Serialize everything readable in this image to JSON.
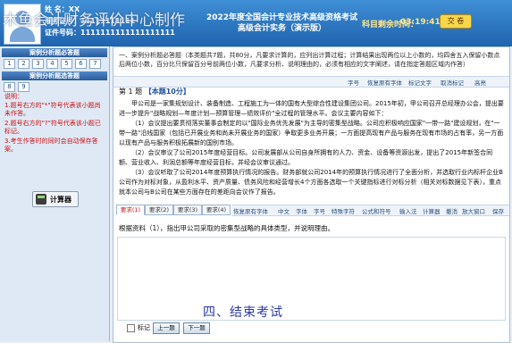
{
  "watermark": "木鱼会计财务评价中心制作",
  "candidate": {
    "name_label": "姓  名：",
    "name_value": "XX",
    "admission_label": "准考证号：",
    "admission_value": "11111111111",
    "id_label": "证件号码：",
    "id_value": "1111111111111111111"
  },
  "exam": {
    "title_line1": "2022年度全国会计专业技术高级资格考试",
    "title_line2": "高级会计实务（演示版）"
  },
  "timer": {
    "label": "科目剩余时间：",
    "value": "03:19:41"
  },
  "submit_label": "交 卷",
  "sidebar": {
    "section1_title": "案例分析题必答题",
    "section1_numbers": [
      "1",
      "2",
      "3",
      "4",
      "5",
      "6",
      "7"
    ],
    "section2_title": "案例分析题选答题",
    "section2_numbers": [
      "8",
      "9"
    ],
    "notes_title": "说明：",
    "notes": [
      "1.题号右方的\"*\"符号代表该小题尚未作答。",
      "2.题号右方的\"?\"符号代表该小题已标记。",
      "3.考生作答时的同时会自动保存答案。"
    ],
    "calculator_label": "计算器"
  },
  "instructions": "一、案例分析题必答题（本类题共7题，共80分，凡要求计算的，应列出计算过程；计算结果出现两位以上小数的，均四舍五入保留小数点后两位小数，百分比只保留百分号前两位小数，凡要求分析、说明理由的，必须有相应的文字阐述，请在指定答题区域内作答）",
  "top_toolbar": {
    "font_size": "字号",
    "restore": "恢复原有字体",
    "mark": "标记文字",
    "unmark": "取消标记",
    "highlight": "高亮"
  },
  "question_title": {
    "num": "第 1 题",
    "points": "【本题10分】"
  },
  "material": [
    "甲公司是一家集规划设计、装备制造、工程施工为一体的国有大型综合性建设集团公司。2015年初，甲公司召开总经理办公会，提出要进一步提升\"战略规划—年度计划—预算管理—绩效评价\"全过程的管理水平。会议主要内容如下：",
    "（1）会议提出要贯彻落实董事会制定的以\"国际业务优先发展\"为主导的密集型战略。公司应积极响应国家\"一带一路\"建设规划，在\"一带一路\"沿线国家（包括已开展业务和尚未开展业务的国家）争取更多业务开展；一方面提高现有产品与服务在现有市场的占有率，另一方面以现有产品与服务积极拓展新的国别市场。",
    "（2）会议审议了公司2015年度经营目标。公司发展部从公司自身所拥有的人力、资金、设备等资源出发，提出了2015年新签合同额、营业收入、利润总额等年度经营目标，并经会议审议通过。",
    "（3）会议听取了公司2014年度预算执行情况的报告。财务部就公司2014年的预算执行情况进行了全面分析，并选取行业内标杆企业B公司作为对标对象，从盈利水平、资产质量、债务风险和经营增长4个方面各选取一个关键指标进行对标分析（相关对标数据见下表），重点就本公司与B公司在某些方面存在的差距向会议作了报告。"
  ],
  "answer_toolbar": {
    "restore": "恢复原有字体",
    "chinese": "中文",
    "font": "字体",
    "size": "字号",
    "special": "特殊字符",
    "equation": "公式和符号",
    "input": "输入法",
    "calculator": "计算器",
    "undo": "撤消",
    "big_window": "放大窗口",
    "save": "保存"
  },
  "answer_tabs": [
    "要求(1)",
    "要求(2)",
    "要求(3)",
    "要求(4)"
  ],
  "question_text": "根据资料（1），指出甲公司采取的密集型战略的具体类型，并说明理由。",
  "end_text": "四、结束考试",
  "mark_label": "标记",
  "prev_label": "上一题",
  "next_label": "下一题"
}
